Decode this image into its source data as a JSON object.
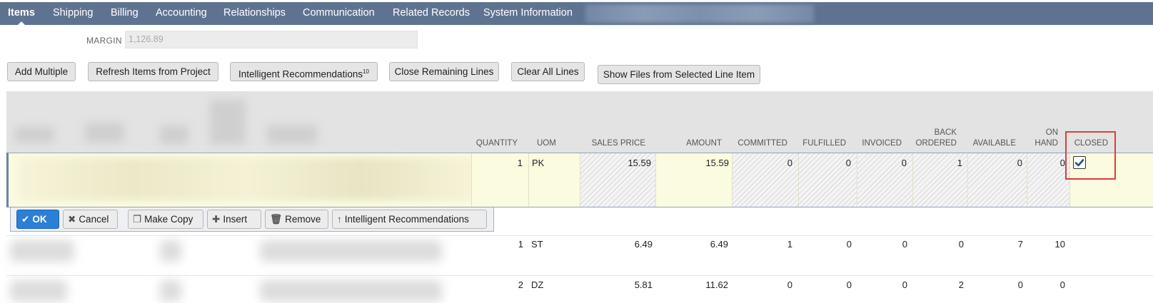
{
  "tabs": [
    {
      "label": "Items",
      "active": true
    },
    {
      "label": "Shipping"
    },
    {
      "label": "Billing"
    },
    {
      "label": "Accounting"
    },
    {
      "label": "Relationships"
    },
    {
      "label": "Communication"
    },
    {
      "label": "Related Records"
    },
    {
      "label": "System Information"
    }
  ],
  "margin": {
    "label": "MARGIN",
    "value": "1,126.89"
  },
  "buttons": {
    "add_multiple": "Add Multiple",
    "refresh": "Refresh Items from Project",
    "intelligent": "Intelligent Recommendations",
    "intelligent_count": "10",
    "close_remaining": "Close Remaining Lines",
    "clear_all": "Clear All Lines",
    "show_files": "Show Files from Selected Line Item"
  },
  "columns": {
    "quantity": "QUANTITY",
    "uom": "UOM",
    "sales_price": "SALES PRICE",
    "amount": "AMOUNT",
    "committed": "COMMITTED",
    "fulfilled": "FULFILLED",
    "invoiced": "INVOICED",
    "back": "BACK",
    "ordered": "ORDERED",
    "available": "AVAILABLE",
    "on": "ON",
    "hand": "HAND",
    "closed": "CLOSED"
  },
  "active_row": {
    "quantity": "1",
    "uom": "PK",
    "sales_price": "15.59",
    "amount": "15.59",
    "committed": "0",
    "fulfilled": "0",
    "invoiced": "0",
    "back_ordered": "1",
    "available": "0",
    "on_hand": "0",
    "closed": true
  },
  "actions": {
    "ok": "OK",
    "cancel": "Cancel",
    "make_copy": "Make Copy",
    "insert": "Insert",
    "remove": "Remove",
    "intelligent": "Intelligent Recommendations"
  },
  "rows": [
    {
      "quantity": "1",
      "uom": "ST",
      "sales_price": "6.49",
      "amount": "6.49",
      "committed": "1",
      "fulfilled": "0",
      "invoiced": "0",
      "back_ordered": "0",
      "available": "7",
      "on_hand": "10"
    },
    {
      "quantity": "2",
      "uom": "DZ",
      "sales_price": "5.81",
      "amount": "11.62",
      "committed": "0",
      "fulfilled": "0",
      "invoiced": "0",
      "back_ordered": "2",
      "available": "0",
      "on_hand": "0"
    }
  ],
  "colors": {
    "tabbar": "#5f7391",
    "ok_button": "#2c7fd6",
    "highlight": "#e03c3c",
    "row_yellow": "#fbfbe0"
  }
}
